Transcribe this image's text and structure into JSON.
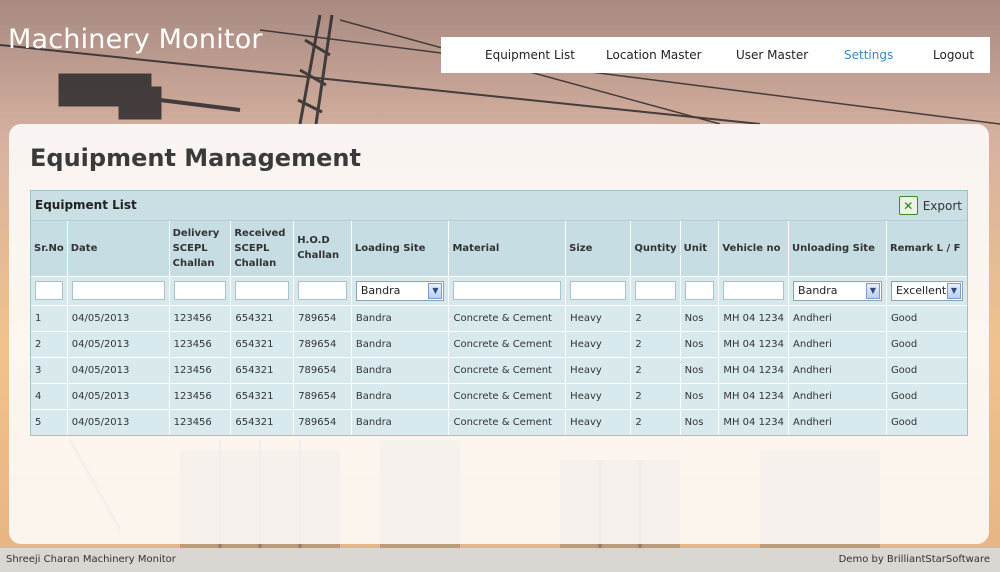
{
  "app": {
    "brand": "Machinery Monitor"
  },
  "nav": {
    "items": [
      {
        "label": "Equipment List",
        "active": false
      },
      {
        "label": "Location Master",
        "active": false
      },
      {
        "label": "User Master",
        "active": false
      },
      {
        "label": "Settings",
        "active": true
      },
      {
        "label": "Logout",
        "active": false
      }
    ],
    "active_color": "#3a86c8"
  },
  "page": {
    "title": "Equipment Management"
  },
  "grid": {
    "caption": "Equipment List",
    "export_label": "Export",
    "export_icon": "excel-icon",
    "columns": [
      [
        "Sr.No"
      ],
      [
        "Date"
      ],
      [
        "Delivery",
        "SCEPL",
        "Challan"
      ],
      [
        "Received",
        "SCEPL",
        "Challan"
      ],
      [
        "H.O.D",
        "Challan"
      ],
      [
        "Loading Site"
      ],
      [
        "Material"
      ],
      [
        "Size"
      ],
      [
        "Quntity"
      ],
      [
        "Unit"
      ],
      [
        "Vehicle no"
      ],
      [
        "Unloading Site"
      ],
      [
        "Remark L / F"
      ]
    ],
    "filters": {
      "loading_site": "Bandra",
      "unloading_site": "Bandra",
      "remark": "Excellent"
    },
    "rows": [
      [
        "1",
        "04/05/2013",
        "123456",
        "654321",
        "789654",
        "Bandra",
        "Concrete & Cement",
        "Heavy",
        "2",
        "Nos",
        "MH 04 1234",
        "Andheri",
        "Good"
      ],
      [
        "2",
        "04/05/2013",
        "123456",
        "654321",
        "789654",
        "Bandra",
        "Concrete & Cement",
        "Heavy",
        "2",
        "Nos",
        "MH 04 1234",
        "Andheri",
        "Good"
      ],
      [
        "3",
        "04/05/2013",
        "123456",
        "654321",
        "789654",
        "Bandra",
        "Concrete & Cement",
        "Heavy",
        "2",
        "Nos",
        "MH 04 1234",
        "Andheri",
        "Good"
      ],
      [
        "4",
        "04/05/2013",
        "123456",
        "654321",
        "789654",
        "Bandra",
        "Concrete & Cement",
        "Heavy",
        "2",
        "Nos",
        "MH 04 1234",
        "Andheri",
        "Good"
      ],
      [
        "5",
        "04/05/2013",
        "123456",
        "654321",
        "789654",
        "Bandra",
        "Concrete & Cement",
        "Heavy",
        "2",
        "Nos",
        "MH 04 1234",
        "Andheri",
        "Good"
      ]
    ]
  },
  "footer": {
    "left": "Shreeji Charan Machinery Monitor",
    "right": "Demo by BrilliantStarSoftware"
  }
}
